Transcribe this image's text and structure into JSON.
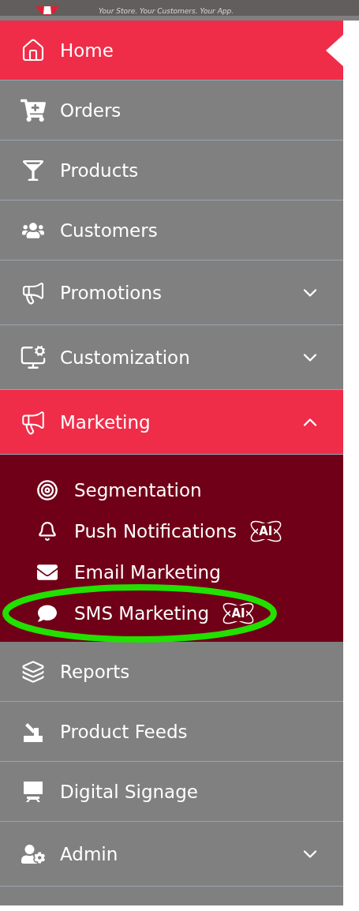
{
  "header": {
    "tagline": "Your Store. Your Customers. Your App."
  },
  "menu": [
    {
      "label": "Home",
      "kind": "item",
      "selected": true
    },
    {
      "label": "Orders",
      "kind": "item",
      "selected": false
    },
    {
      "label": "Products",
      "kind": "item",
      "selected": false
    },
    {
      "label": "Customers",
      "kind": "item",
      "selected": false
    },
    {
      "label": "Promotions",
      "kind": "group",
      "selected": false,
      "expanded": false
    },
    {
      "label": "Customization",
      "kind": "group",
      "selected": false,
      "expanded": false
    },
    {
      "label": "Marketing",
      "kind": "group",
      "selected": false,
      "expanded": true,
      "children": [
        {
          "label": "Segmentation",
          "circled": false
        },
        {
          "label": "Push Notifications",
          "badge": "AI",
          "circled": false
        },
        {
          "label": "Email Marketing",
          "circled": false
        },
        {
          "label": "SMS Marketing",
          "badge": "AI",
          "circled": true
        }
      ]
    },
    {
      "label": "Reports",
      "kind": "item",
      "selected": false
    },
    {
      "label": "Product Feeds",
      "kind": "item",
      "selected": false
    },
    {
      "label": "Digital Signage",
      "kind": "item",
      "selected": false
    },
    {
      "label": "Admin",
      "kind": "group",
      "selected": false,
      "expanded": false
    }
  ]
}
